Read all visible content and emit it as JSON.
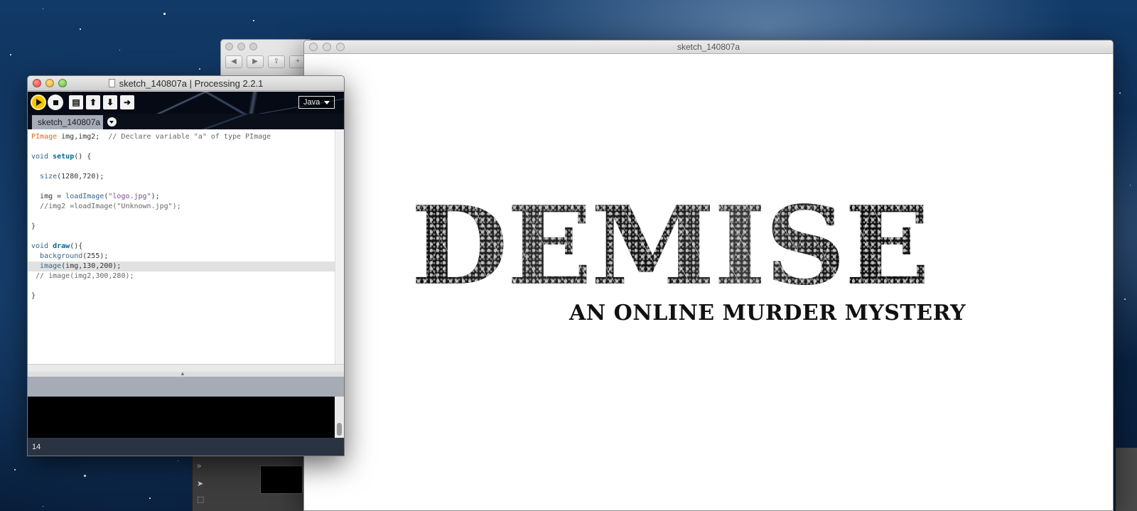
{
  "desktop": {
    "colors": {
      "sky": "#0d2a4e"
    }
  },
  "browser_window": {
    "buttons": [
      "◀",
      "▶",
      "⇪",
      "+"
    ]
  },
  "sketch_window": {
    "title": "sketch_140807a",
    "logo": {
      "title": "DEMISE",
      "subtitle": "AN ONLINE MURDER MYSTERY"
    }
  },
  "pde_window": {
    "title": "sketch_140807a | Processing 2.2.1",
    "toolbar": {
      "run_icon": "play-icon",
      "stop_icon": "stop-icon",
      "new_icon": "new-file-icon",
      "open_icon": "open-arrow-up-icon",
      "save_icon": "save-arrow-down-icon",
      "export_icon": "export-arrow-icon",
      "mode": "Java"
    },
    "tab": {
      "label": "sketch_140807a"
    },
    "code": [
      {
        "type": "PImage",
        "rest": " img,img2;  ",
        "comment": "// Declare variable \"a\" of type PImage"
      },
      {
        "text": ""
      },
      {
        "kw": "void",
        "fn": "setup",
        "rest": "() {"
      },
      {
        "text": ""
      },
      {
        "fn": "size",
        "rest": "(1280,720);"
      },
      {
        "text": ""
      },
      {
        "pre": "img = ",
        "fn": "loadImage",
        "str": "\"logo.jpg\"",
        "rest": ");"
      },
      {
        "comment": "//img2 =loadImage(\"Unknown.jpg\");"
      },
      {
        "text": ""
      },
      {
        "text": "}"
      },
      {
        "text": ""
      },
      {
        "kw": "void",
        "fn": "draw",
        "rest": "(){"
      },
      {
        "fn": "background",
        "rest": "(255);"
      },
      {
        "fn": "image",
        "rest": "(img,130,200);"
      },
      {
        "comment": "// image(img2,300,280);"
      },
      {
        "text": ""
      },
      {
        "text": "}"
      }
    ],
    "status_line": "14"
  }
}
